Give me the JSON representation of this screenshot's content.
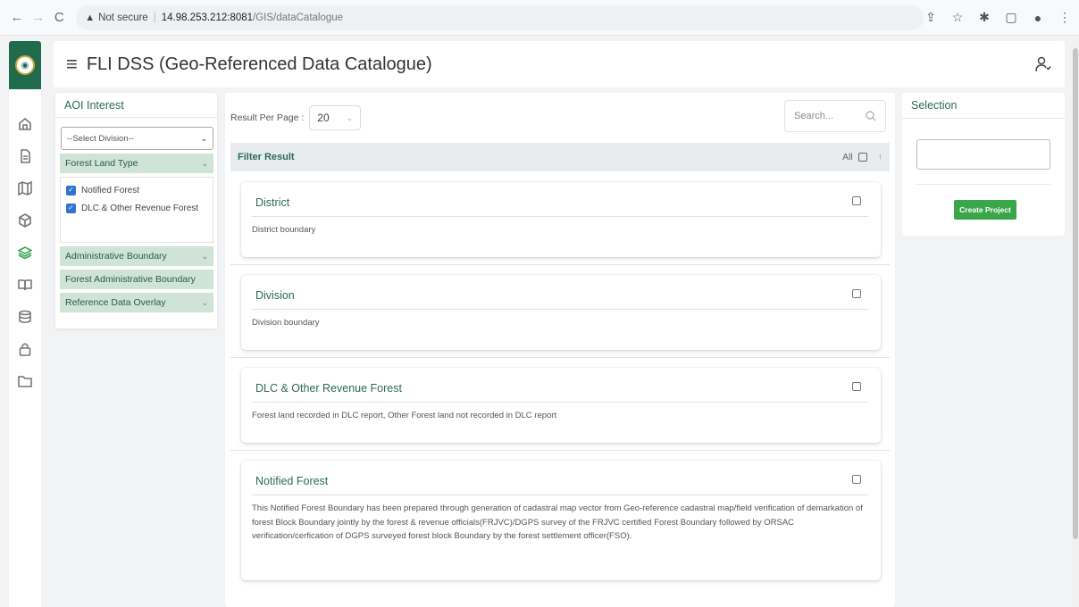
{
  "browser": {
    "security_label": "Not secure",
    "url_host": "14.98.253.212:8081",
    "url_path": "/GIS/dataCatalogue"
  },
  "header": {
    "title": "FLI DSS (Geo-Referenced Data Catalogue)"
  },
  "aoi": {
    "title": "AOI Interest",
    "division_select": "--Select Division--",
    "sections": [
      "Forest Land Type",
      "Administrative Boundary",
      "Forest Administrative Boundary",
      "Reference Data Overlay"
    ],
    "forest_types": [
      "Notified Forest",
      "DLC & Other Revenue Forest"
    ]
  },
  "results": {
    "per_page_label": "Result Per Page :",
    "per_page_value": "20",
    "search_placeholder": "Search...",
    "filter_title": "Filter Result",
    "all_label": "All",
    "items": [
      {
        "title": "District",
        "description": "District boundary"
      },
      {
        "title": "Division",
        "description": "Division boundary"
      },
      {
        "title": "DLC & Other Revenue Forest",
        "description": "Forest land recorded in DLC report, Other Forest land not recorded in DLC report"
      },
      {
        "title": "Notified Forest",
        "description": "This Notified Forest Boundary has been prepared through generation of cadastral map vector from Geo-reference cadastral map/field verification of demarkation of forest Block Boundary jointly by the forest & revenue officials(FRJVC)/DGPS survey of the FRJVC certified Forest Boundary followed by ORSAC verification/cerfication of DGPS surveyed forest block Boundary by the forest settlement officer(FSO)."
      }
    ]
  },
  "selection": {
    "title": "Selection",
    "create_button": "Create Project"
  },
  "colors": {
    "brand_green": "#2a6b58",
    "accent_green": "#3aa64a",
    "accordion_bg": "#cfe3d6",
    "checkbox_blue": "#2f74d0"
  }
}
